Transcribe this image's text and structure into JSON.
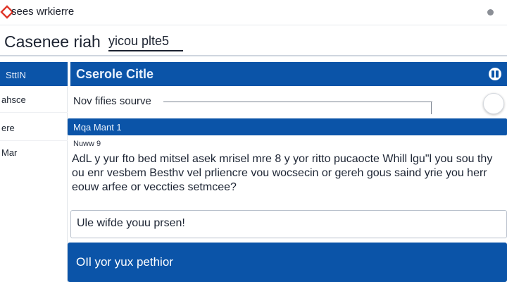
{
  "topbar": {
    "site_name": "sees wrkierre",
    "logo_icon": "diamond-logo-icon"
  },
  "header": {
    "title": "Casenee riah",
    "link": "yicou plte5"
  },
  "sidebar": {
    "head": "SttIN",
    "items": [
      {
        "label": "ahsce"
      },
      {
        "label": "ere"
      },
      {
        "label": "Mar"
      }
    ]
  },
  "card": {
    "title": "Cserole Citle",
    "source_label": "Nov fifies sourve",
    "section_title": "Mqa Mant 1",
    "prompt_label": "Nuww 9",
    "prompt_text": "AdL y yur fto bed mitsel asek mrisel mre 8 y yor ritto pucaocte Whill lgu\"l you sou thy ou enr vesbem Besthv vel prliencre vou wocsecin or gereh gous saind yrie you herr eouw arfee or veccties setmcee?",
    "answer_value": "Ule wifde youu prsen!",
    "submit_label": "OIl yor yux pethior"
  },
  "colors": {
    "accent": "#0b54a8",
    "logo": "#e0382b"
  }
}
